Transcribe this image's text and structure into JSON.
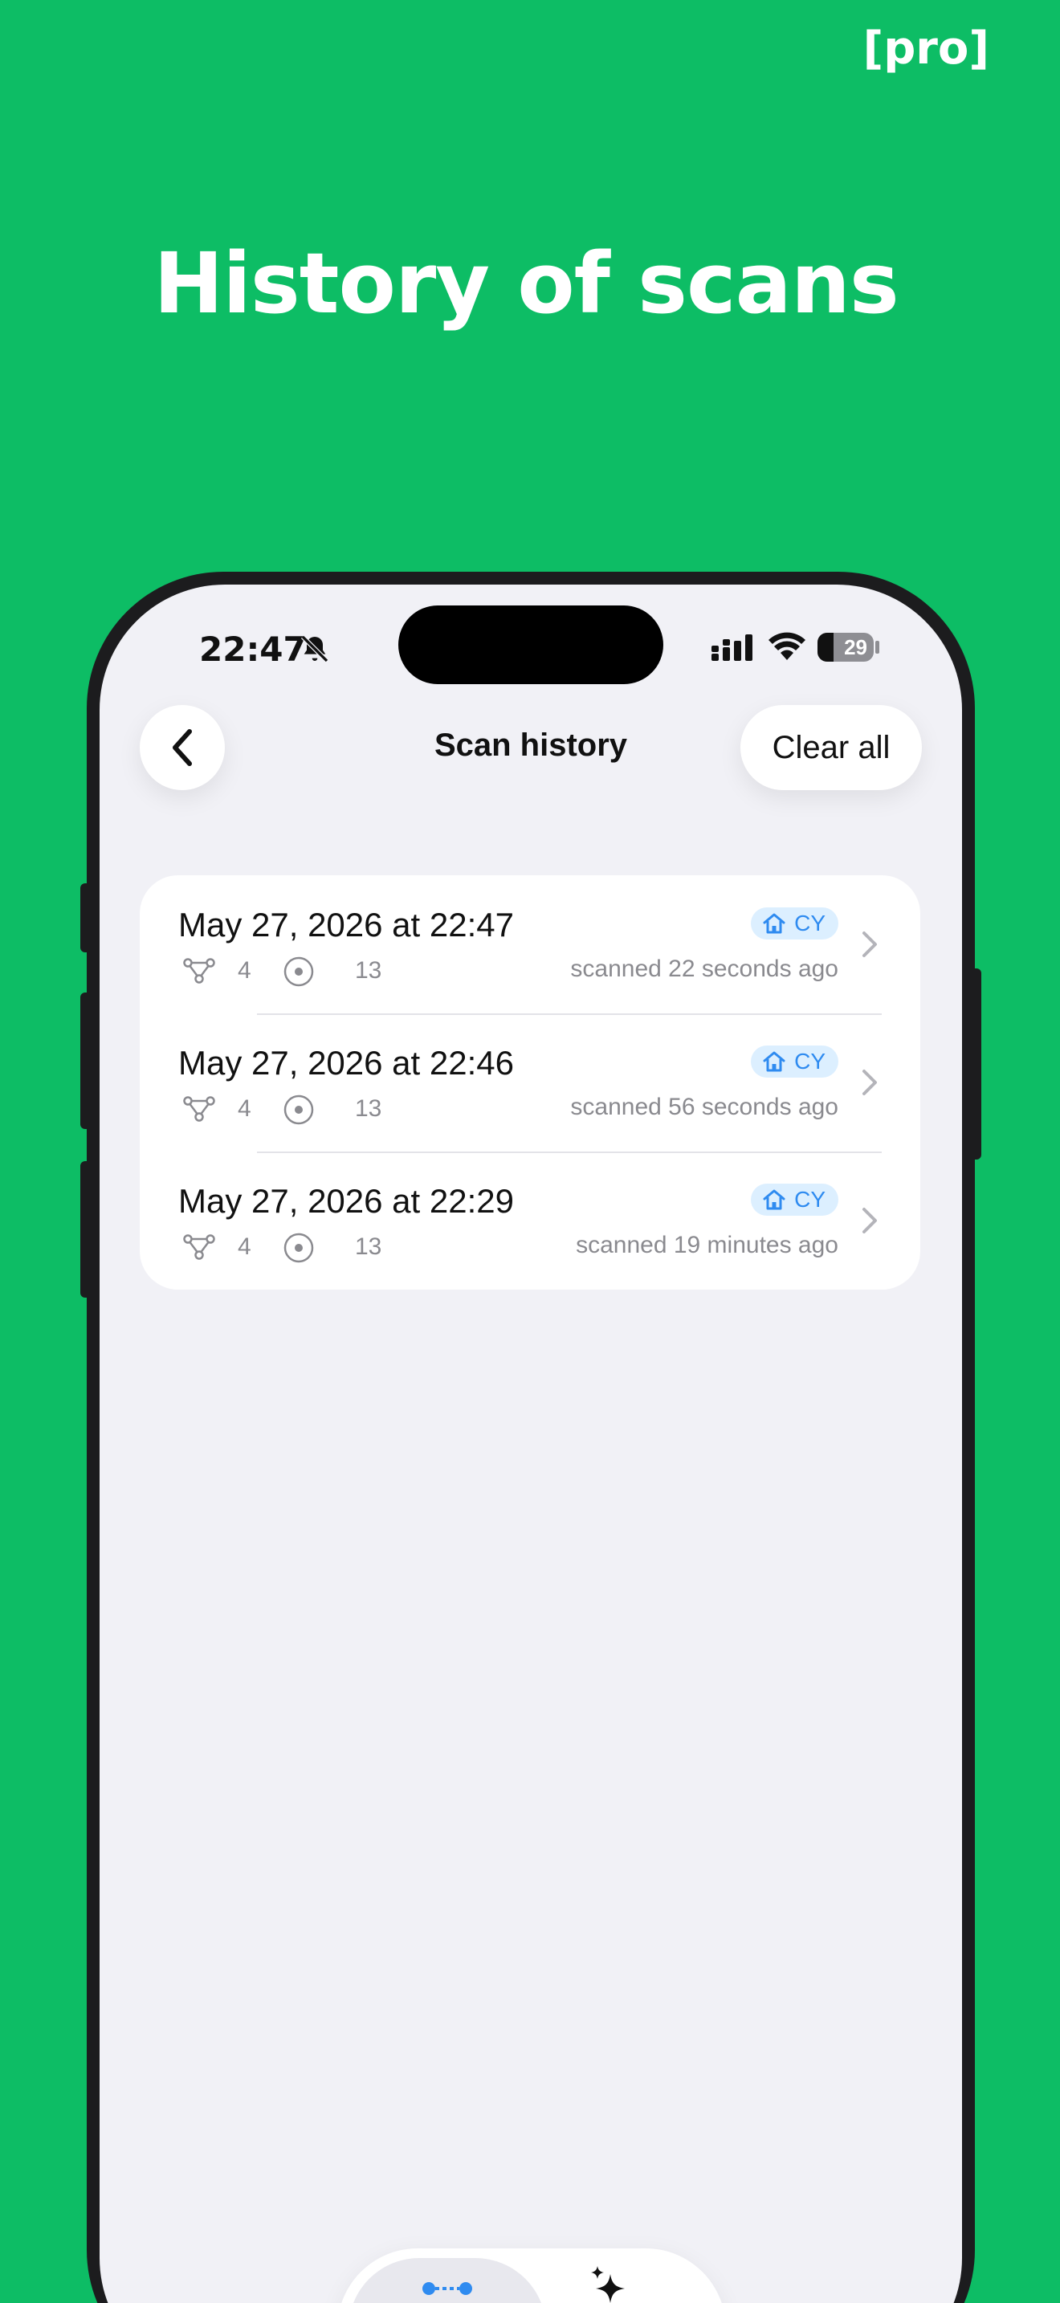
{
  "promo": {
    "badge": "[pro]",
    "title": "History of scans"
  },
  "status_bar": {
    "time": "22:47",
    "battery": 29
  },
  "header": {
    "title": "Scan history",
    "clear_label": "Clear all"
  },
  "scans": [
    {
      "date": "May 27, 2026 at 22:47",
      "devices": "4",
      "points": "13",
      "badge": "CY",
      "ago": "scanned 22 seconds ago"
    },
    {
      "date": "May 27, 2026 at 22:46",
      "devices": "4",
      "points": "13",
      "badge": "CY",
      "ago": "scanned 56 seconds ago"
    },
    {
      "date": "May 27, 2026 at 22:29",
      "devices": "4",
      "points": "13",
      "badge": "CY",
      "ago": "scanned 19 minutes ago"
    }
  ],
  "icons": {
    "back": "chevron-left-icon",
    "network": "network-nodes-icon",
    "points": "target-icon",
    "home": "home-icon",
    "row_chevron": "chevron-right-icon",
    "tab_scan": "scan-network-icon",
    "tab_ai": "sparkles-icon"
  },
  "colors": {
    "background": "#0dbd65",
    "accent": "#2f8bf0",
    "badge_bg": "#dcefff",
    "screen_bg": "#f1f1f6"
  }
}
